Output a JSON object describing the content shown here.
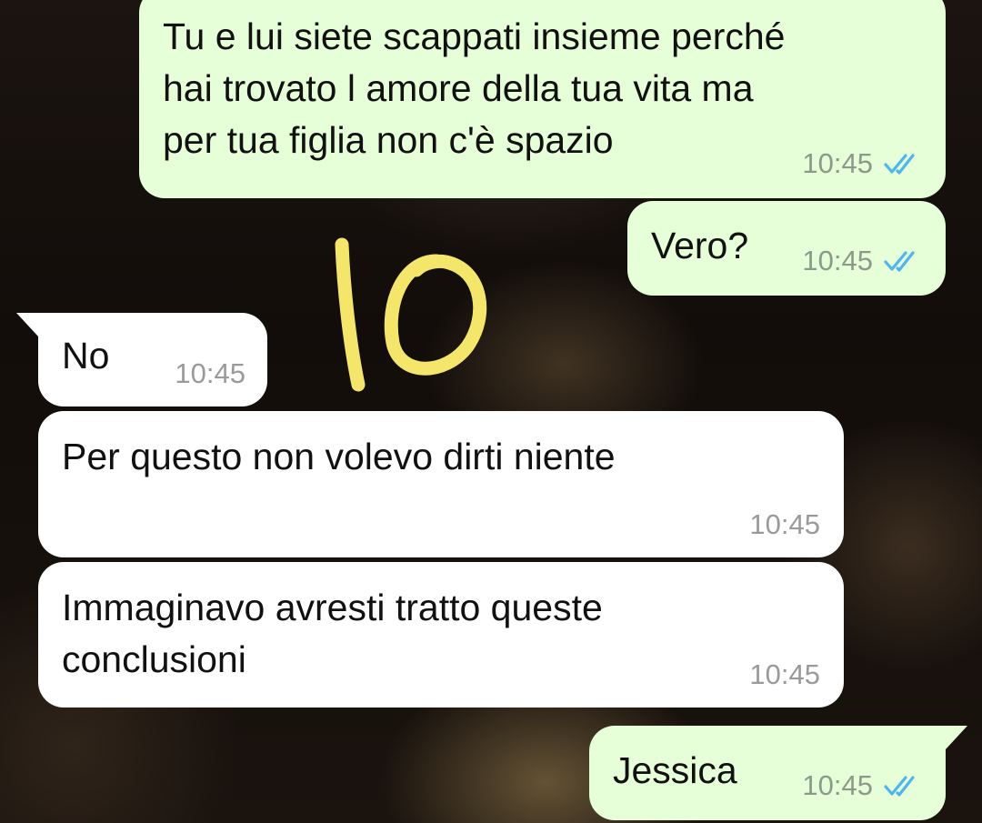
{
  "messages": [
    {
      "direction": "outgoing",
      "lines": [
        "Tu e lui siete scappati insieme perché",
        "hai trovato l amore della tua vita ma",
        "per tua figlia non c'è spazio"
      ],
      "time": "10:45",
      "status": "read",
      "status_icon": "double-check-icon"
    },
    {
      "direction": "outgoing",
      "lines": [
        "Vero?"
      ],
      "time": "10:45",
      "status": "read",
      "status_icon": "double-check-icon"
    },
    {
      "direction": "incoming",
      "lines": [
        "No"
      ],
      "time": "10:45"
    },
    {
      "direction": "incoming",
      "lines": [
        "Per questo non volevo dirti niente"
      ],
      "time": "10:45"
    },
    {
      "direction": "incoming",
      "lines": [
        "Immaginavo avresti tratto queste",
        "conclusioni"
      ],
      "time": "10:45"
    },
    {
      "direction": "outgoing",
      "lines": [
        "Jessica"
      ],
      "time": "10:45",
      "status": "read",
      "status_icon": "double-check-icon"
    }
  ],
  "annotation": {
    "text": "10",
    "color": "#f4e66a"
  },
  "colors": {
    "outgoing_bubble": "#e6ffd9",
    "incoming_bubble": "#ffffff",
    "read_ticks": "#4fb6ec",
    "timestamp": "#8d9a8a"
  }
}
